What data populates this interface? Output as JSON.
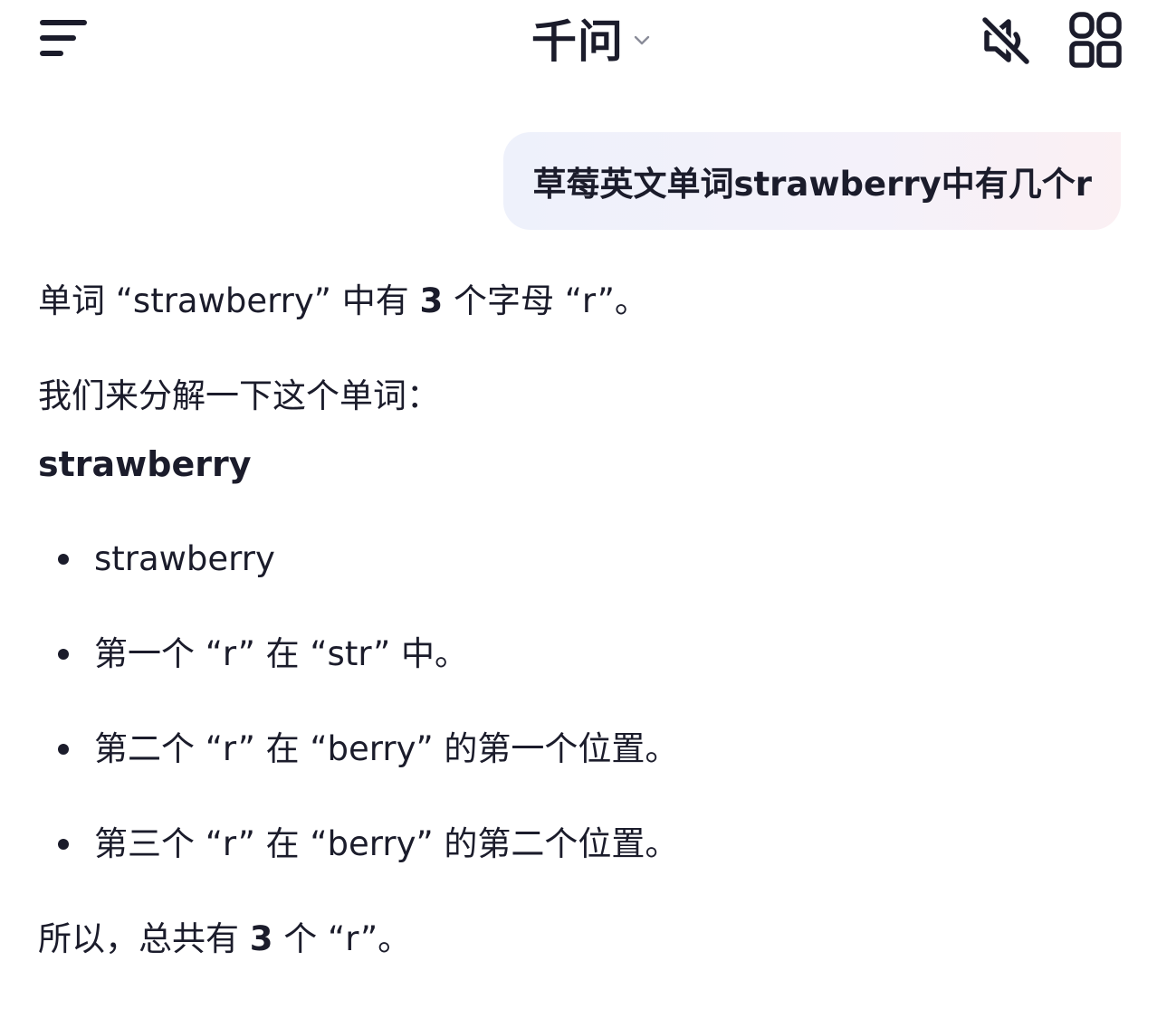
{
  "header": {
    "title": "千问",
    "menu_icon": "menu-icon",
    "chevron_icon": "chevron-down-icon",
    "mute_icon": "speaker-muted-icon",
    "apps_icon": "grid-apps-icon"
  },
  "chat": {
    "user_message": "草莓英文单词strawberry中有几个r",
    "answer": {
      "line1_prefix": "单词 “strawberry” 中有 ",
      "line1_count": "3",
      "line1_suffix": " 个字母 “r”。",
      "line2": "我们来分解一下这个单词：",
      "word_heading": "strawberry",
      "bullets": [
        "strawberry",
        "第一个 “r” 在 “str” 中。",
        "第二个 “r” 在 “berry” 的第一个位置。",
        "第三个 “r” 在 “berry” 的第二个位置。"
      ],
      "summary_prefix": "所以，总共有 ",
      "summary_count": "3",
      "summary_suffix": " 个 “r”。"
    }
  },
  "colors": {
    "text": "#1b1c2b",
    "bubble_start": "#eef1fb",
    "bubble_end": "#fbf0f3"
  }
}
